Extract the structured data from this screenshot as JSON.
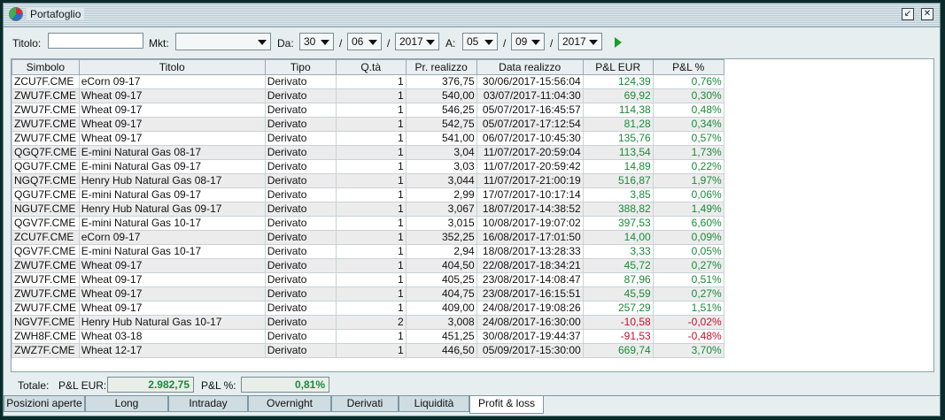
{
  "window": {
    "title": "Portafoglio"
  },
  "toolbar": {
    "titolo_label": "Titolo:",
    "titolo_value": "",
    "mkt_label": "Mkt:",
    "mkt_value": "",
    "da_label": "Da:",
    "da_day": "30",
    "da_month": "06",
    "da_year": "2017",
    "a_label": "A:",
    "a_day": "05",
    "a_month": "09",
    "a_year": "2017",
    "slash": "/"
  },
  "table": {
    "columns": [
      "Simbolo",
      "Titolo",
      "Tipo",
      "Q.tà",
      "Pr. realizzo",
      "Data realizzo",
      "P&L EUR",
      "P&L %"
    ],
    "rows": [
      [
        "ZCU7F.CME",
        "eCorn 09-17",
        "Derivato",
        "1",
        "376,75",
        "30/06/2017-15:56:04",
        "124,39",
        "0,76%"
      ],
      [
        "ZWU7F.CME",
        "Wheat 09-17",
        "Derivato",
        "1",
        "540,00",
        "03/07/2017-11:04:30",
        "69,92",
        "0,30%"
      ],
      [
        "ZWU7F.CME",
        "Wheat 09-17",
        "Derivato",
        "1",
        "546,25",
        "05/07/2017-16:45:57",
        "114,38",
        "0,48%"
      ],
      [
        "ZWU7F.CME",
        "Wheat 09-17",
        "Derivato",
        "1",
        "542,75",
        "05/07/2017-17:12:54",
        "81,28",
        "0,34%"
      ],
      [
        "ZWU7F.CME",
        "Wheat 09-17",
        "Derivato",
        "1",
        "541,00",
        "06/07/2017-10:45:30",
        "135,76",
        "0,57%"
      ],
      [
        "QGQ7F.CME",
        "E-mini Natural Gas 08-17",
        "Derivato",
        "1",
        "3,04",
        "11/07/2017-20:59:04",
        "113,54",
        "1,73%"
      ],
      [
        "QGU7F.CME",
        "E-mini Natural Gas 09-17",
        "Derivato",
        "1",
        "3,03",
        "11/07/2017-20:59:42",
        "14,89",
        "0,22%"
      ],
      [
        "NGQ7F.CME",
        "Henry Hub Natural Gas 08-17",
        "Derivato",
        "1",
        "3,044",
        "11/07/2017-21:00:19",
        "516,87",
        "1,97%"
      ],
      [
        "QGU7F.CME",
        "E-mini Natural Gas 09-17",
        "Derivato",
        "1",
        "2,99",
        "17/07/2017-10:17:14",
        "3,85",
        "0,06%"
      ],
      [
        "NGU7F.CME",
        "Henry Hub Natural Gas 09-17",
        "Derivato",
        "1",
        "3,067",
        "18/07/2017-14:38:52",
        "388,82",
        "1,49%"
      ],
      [
        "QGV7F.CME",
        "E-mini Natural Gas 10-17",
        "Derivato",
        "1",
        "3,015",
        "10/08/2017-19:07:02",
        "397,53",
        "6,60%"
      ],
      [
        "ZCU7F.CME",
        "eCorn 09-17",
        "Derivato",
        "1",
        "352,25",
        "16/08/2017-17:01:50",
        "14,00",
        "0,09%"
      ],
      [
        "QGV7F.CME",
        "E-mini Natural Gas 10-17",
        "Derivato",
        "1",
        "2,94",
        "18/08/2017-13:28:33",
        "3,33",
        "0,05%"
      ],
      [
        "ZWU7F.CME",
        "Wheat 09-17",
        "Derivato",
        "1",
        "404,50",
        "22/08/2017-18:34:21",
        "45,72",
        "0,27%"
      ],
      [
        "ZWU7F.CME",
        "Wheat 09-17",
        "Derivato",
        "1",
        "405,25",
        "23/08/2017-14:08:47",
        "87,96",
        "0,51%"
      ],
      [
        "ZWU7F.CME",
        "Wheat 09-17",
        "Derivato",
        "1",
        "404,75",
        "23/08/2017-16:15:51",
        "45,59",
        "0,27%"
      ],
      [
        "ZWU7F.CME",
        "Wheat 09-17",
        "Derivato",
        "1",
        "409,00",
        "24/08/2017-19:08:26",
        "257,29",
        "1,51%"
      ],
      [
        "NGV7F.CME",
        "Henry Hub Natural Gas 10-17",
        "Derivato",
        "2",
        "3,008",
        "24/08/2017-16:30:00",
        "-10,58",
        "-0,02%"
      ],
      [
        "ZWH8F.CME",
        "Wheat 03-18",
        "Derivato",
        "1",
        "451,25",
        "30/08/2017-19:44:37",
        "-91,53",
        "-0,48%"
      ],
      [
        "ZWZ7F.CME",
        "Wheat 12-17",
        "Derivato",
        "1",
        "446,50",
        "05/09/2017-15:30:00",
        "669,74",
        "3,70%"
      ]
    ]
  },
  "totals": {
    "label": "Totale:",
    "pl_eur_label": "P&L EUR:",
    "pl_eur_value": "2.982,75",
    "pl_pct_label": "P&L %:",
    "pl_pct_value": "0,81%"
  },
  "tabs": [
    "Posizioni aperte",
    "Long",
    "Intraday",
    "Overnight",
    "Derivati",
    "Liquidità",
    "Profit & loss"
  ],
  "active_tab": "Profit & loss",
  "colors": {
    "positive": "#1a8a3a",
    "negative": "#c8102e",
    "go": "#1f9a2a"
  },
  "icons": {
    "app": "pie-chart-icon",
    "restore": "restore-icon",
    "close": "close-icon",
    "run": "play-icon"
  }
}
